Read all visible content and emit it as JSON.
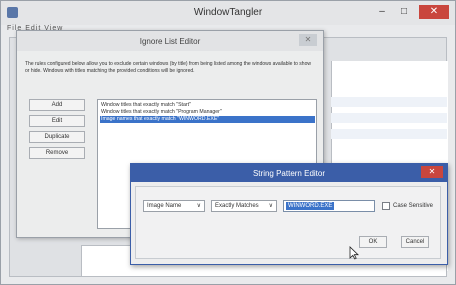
{
  "main_window": {
    "title": "WindowTangler",
    "menu": "File  Edit  View",
    "controls": {
      "minimize": "–",
      "maximize": "□",
      "close": "✕"
    }
  },
  "ignore_list_editor": {
    "title": "Ignore List Editor",
    "close": "✕",
    "description": "The rules configured below allow you to exclude certain windows (by title) from being listed among the windows available to show or hide. Windows with titles matching the provided conditions will be ignored.",
    "buttons": {
      "add": "Add",
      "edit": "Edit",
      "duplicate": "Duplicate",
      "remove": "Remove"
    },
    "rules": [
      {
        "text": "Window titles that exactly match \"Start\"",
        "selected": false
      },
      {
        "text": "Window titles that exactly match \"Program Manager\"",
        "selected": false
      },
      {
        "text": "Image names that exactly match \"WINWORD.EXE\"",
        "selected": true
      }
    ]
  },
  "string_pattern_editor": {
    "title": "String Pattern Editor",
    "close": "✕",
    "field_select": "Image Name",
    "match_select": "Exactly Matches",
    "pattern_value": "WINWORD.EXE",
    "case_sensitive_label": "Case Sensitive",
    "case_sensitive_checked": false,
    "ok_label": "OK",
    "cancel_label": "Cancel"
  },
  "colors": {
    "accent": "#3b5ea8",
    "selection": "#3b73c9",
    "close_red": "#c9463d"
  }
}
